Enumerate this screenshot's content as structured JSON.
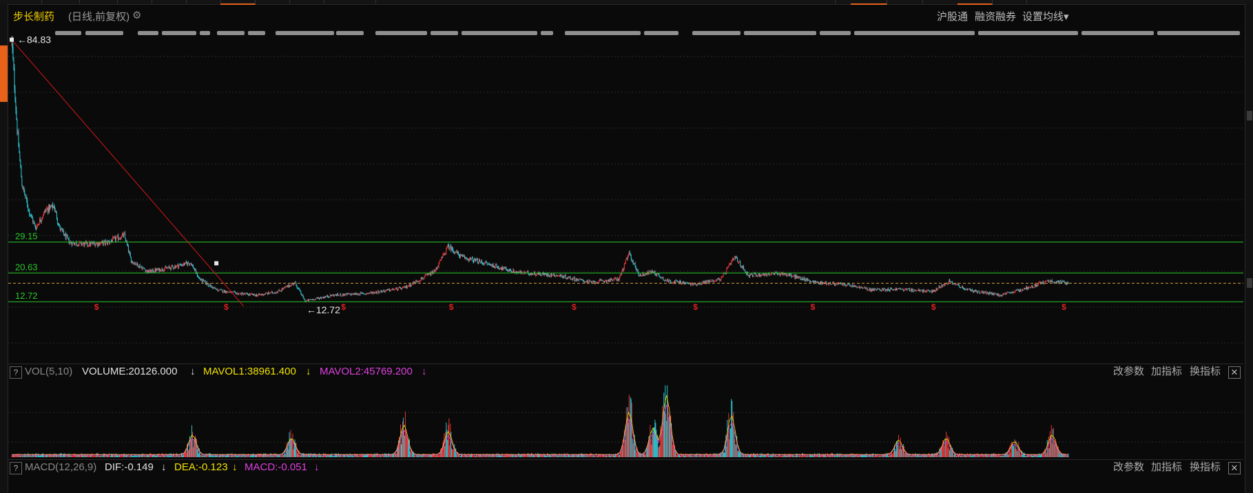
{
  "header": {
    "stock_name": "步长制药",
    "period_label": "(日线,前复权)",
    "links": [
      "沪股通",
      "融资融券",
      "设置均线▾"
    ]
  },
  "main_chart": {
    "high_label": "84.83",
    "low_label": "12.72",
    "levels": [
      {
        "label": "29.15",
        "value": 29.15
      },
      {
        "label": "20.63",
        "value": 20.63
      },
      {
        "label": "12.72",
        "value": 12.72
      }
    ],
    "dashed_level": 17.8,
    "y_range": [
      12.0,
      85.5
    ],
    "colors": {
      "up": "#ff3a3a",
      "down": "#33d6e6",
      "level": "#29c929",
      "trend": "#d81818",
      "marker": "#e02020"
    }
  },
  "vol_panel": {
    "indicator": "VOL(5,10)",
    "volume": "VOLUME:20126.000",
    "mavol1": "MAVOL1:38961.400",
    "mavol2": "MAVOL2:45769.200",
    "arrow": "↓",
    "buttons": [
      "改参数",
      "加指标",
      "换指标"
    ],
    "close": "✕",
    "help": "?"
  },
  "macd_panel": {
    "indicator": "MACD(12,26,9)",
    "dif": "DIF:-0.149",
    "dea": "DEA:-0.123",
    "macd": "MACD:-0.051",
    "arrow": "↓",
    "buttons": [
      "改参数",
      "加指标",
      "换指标"
    ],
    "close": "✕",
    "help": "?"
  },
  "chart_data": {
    "type": "candlestick",
    "x_count": 1550,
    "price_path": [
      [
        0,
        84.8
      ],
      [
        8,
        60
      ],
      [
        15,
        45
      ],
      [
        25,
        38
      ],
      [
        35,
        33
      ],
      [
        50,
        38
      ],
      [
        62,
        39
      ],
      [
        70,
        33
      ],
      [
        85,
        29
      ],
      [
        110,
        28.5
      ],
      [
        140,
        29
      ],
      [
        165,
        31
      ],
      [
        175,
        24
      ],
      [
        200,
        21
      ],
      [
        230,
        22
      ],
      [
        262,
        23.5
      ],
      [
        275,
        19
      ],
      [
        300,
        16
      ],
      [
        330,
        15
      ],
      [
        360,
        14.5
      ],
      [
        390,
        15.5
      ],
      [
        415,
        18
      ],
      [
        430,
        12.9
      ],
      [
        470,
        14.5
      ],
      [
        520,
        15
      ],
      [
        575,
        16.5
      ],
      [
        620,
        21
      ],
      [
        640,
        28
      ],
      [
        660,
        25
      ],
      [
        700,
        23
      ],
      [
        740,
        20.8
      ],
      [
        800,
        20
      ],
      [
        850,
        18
      ],
      [
        890,
        19
      ],
      [
        905,
        26
      ],
      [
        920,
        20
      ],
      [
        940,
        21
      ],
      [
        960,
        18.5
      ],
      [
        1000,
        17.5
      ],
      [
        1040,
        19
      ],
      [
        1060,
        25
      ],
      [
        1080,
        20
      ],
      [
        1130,
        20.5
      ],
      [
        1180,
        18
      ],
      [
        1220,
        17.5
      ],
      [
        1260,
        16
      ],
      [
        1300,
        16.2
      ],
      [
        1350,
        15.5
      ],
      [
        1375,
        18.5
      ],
      [
        1400,
        16
      ],
      [
        1450,
        14.5
      ],
      [
        1480,
        16
      ],
      [
        1520,
        18.5
      ],
      [
        1550,
        17.8
      ]
    ],
    "volume_spikes": [
      [
        265,
        0.3
      ],
      [
        410,
        0.25
      ],
      [
        575,
        0.45
      ],
      [
        640,
        0.35
      ],
      [
        905,
        0.65
      ],
      [
        940,
        0.4
      ],
      [
        960,
        0.9
      ],
      [
        1055,
        0.6
      ],
      [
        1300,
        0.22
      ],
      [
        1370,
        0.25
      ],
      [
        1470,
        0.2
      ],
      [
        1525,
        0.3
      ]
    ],
    "markers_x": [
      125,
      315,
      487,
      645,
      825,
      1003,
      1175,
      1352,
      1543
    ],
    "trendline": [
      [
        0,
        84.8
      ],
      [
        340,
        11.5
      ]
    ],
    "series": [
      {
        "name": "VOLUME",
        "latest": 20126.0
      },
      {
        "name": "MAVOL1",
        "latest": 38961.4
      },
      {
        "name": "MAVOL2",
        "latest": 45769.2
      },
      {
        "name": "DIF",
        "latest": -0.149
      },
      {
        "name": "DEA",
        "latest": -0.123
      },
      {
        "name": "MACD",
        "latest": -0.051
      }
    ]
  }
}
